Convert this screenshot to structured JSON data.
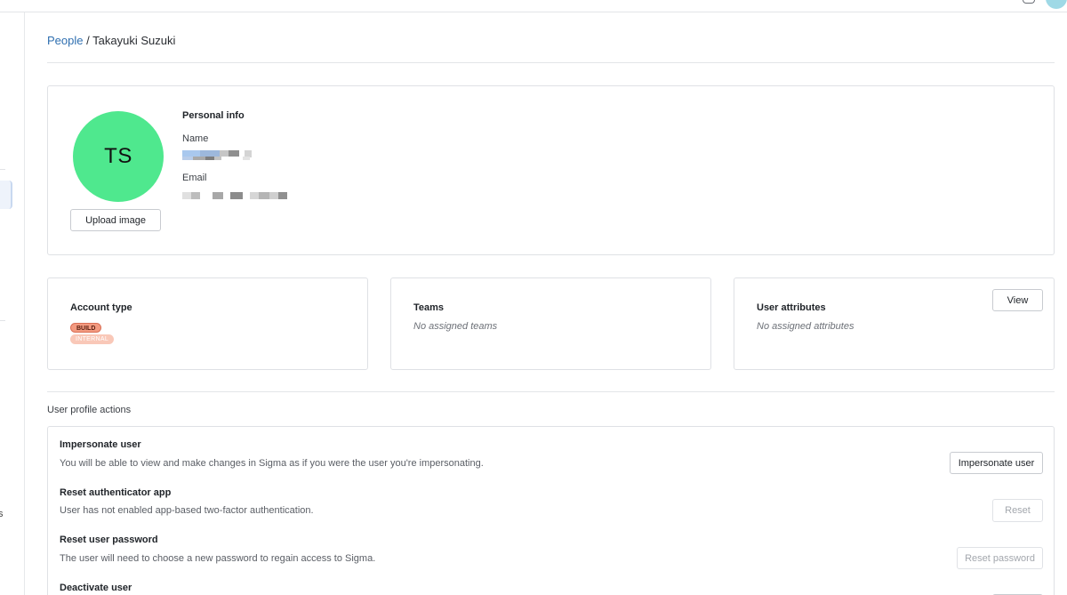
{
  "breadcrumb": {
    "parent": "People",
    "separator": "/",
    "current": "Takayuki Suzuki"
  },
  "sidebar": {
    "truncated_label": "s"
  },
  "profile": {
    "initials": "TS",
    "upload_button": "Upload image",
    "section_title": "Personal info",
    "name_label": "Name",
    "email_label": "Email"
  },
  "account_type": {
    "title": "Account type",
    "badges": [
      "BUILD",
      "INTERNAL"
    ]
  },
  "teams": {
    "title": "Teams",
    "empty": "No assigned teams"
  },
  "user_attributes": {
    "title": "User attributes",
    "empty": "No assigned attributes",
    "view_button": "View"
  },
  "actions": {
    "heading": "User profile actions",
    "items": [
      {
        "title": "Impersonate user",
        "description": "You will be able to view and make changes in Sigma as if you were the user you're impersonating.",
        "button": "Impersonate user",
        "enabled": true
      },
      {
        "title": "Reset authenticator app",
        "description": "User has not enabled app-based two-factor authentication.",
        "button": "Reset",
        "enabled": false
      },
      {
        "title": "Reset user password",
        "description": "The user will need to choose a new password to regain access to Sigma.",
        "button": "Reset password",
        "enabled": false
      },
      {
        "title": "Deactivate user",
        "description": "",
        "button": "",
        "enabled": false
      }
    ]
  },
  "colors": {
    "avatar": "#4fe88e",
    "link": "#2f6fb0",
    "badge_build": "#f39a80",
    "badge_internal": "#f9c8b8"
  }
}
